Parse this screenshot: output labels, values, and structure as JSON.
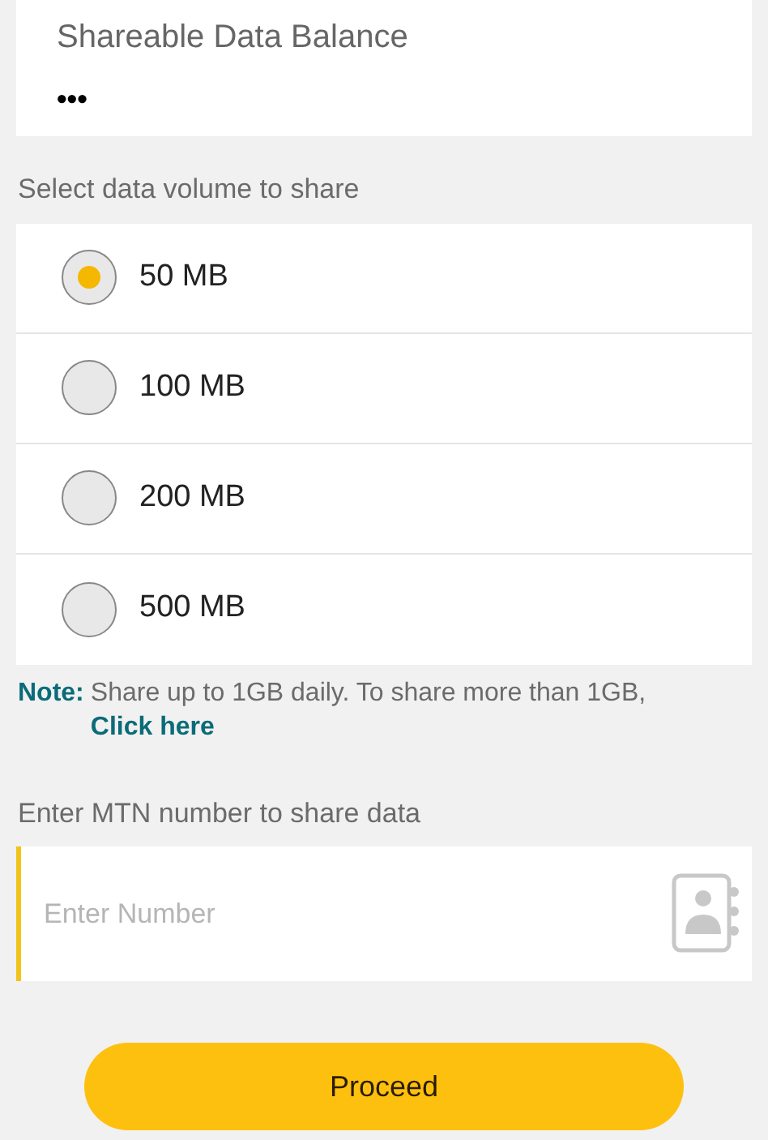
{
  "balance_card": {
    "title": "Shareable Data Balance",
    "value": "•••"
  },
  "volume_section": {
    "label": "Select data volume to share",
    "options": [
      {
        "label": "50 MB",
        "selected": true
      },
      {
        "label": "100 MB",
        "selected": false
      },
      {
        "label": "200 MB",
        "selected": false
      },
      {
        "label": "500 MB",
        "selected": false
      }
    ]
  },
  "note": {
    "label": "Note:",
    "text": "Share up to 1GB daily. To share more than 1GB,",
    "link": "Click here"
  },
  "number_section": {
    "label": "Enter MTN number to share data",
    "placeholder": "Enter Number"
  },
  "proceed_button": "Proceed"
}
